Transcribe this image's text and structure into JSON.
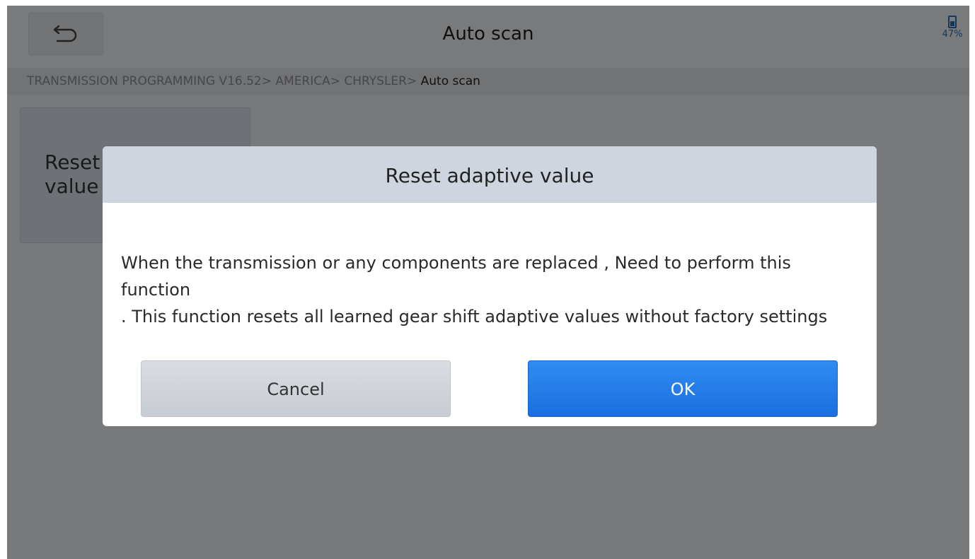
{
  "header": {
    "title": "Auto scan",
    "back_icon": "back-arrow-icon",
    "battery_icon": "battery-icon",
    "battery_text": "47%",
    "battery_level": 0.47
  },
  "breadcrumb": {
    "items": [
      "TRANSMISSION PROGRAMMING V16.52>",
      "AMERICA>",
      "CHRYSLER>"
    ],
    "current": "Auto scan"
  },
  "function_tile": {
    "label_line1": "Reset adaptive",
    "label_line2": "value"
  },
  "dialog": {
    "title": "Reset adaptive value",
    "message_line1": "When the transmission or any components are replaced , Need to perform this function",
    "message_line2": ". This function resets all learned gear shift adaptive values without factory settings",
    "cancel_label": "Cancel",
    "ok_label": "OK"
  },
  "colors": {
    "accent": "#1a73e8",
    "overlay": "rgba(0,0,0,0.5)"
  }
}
